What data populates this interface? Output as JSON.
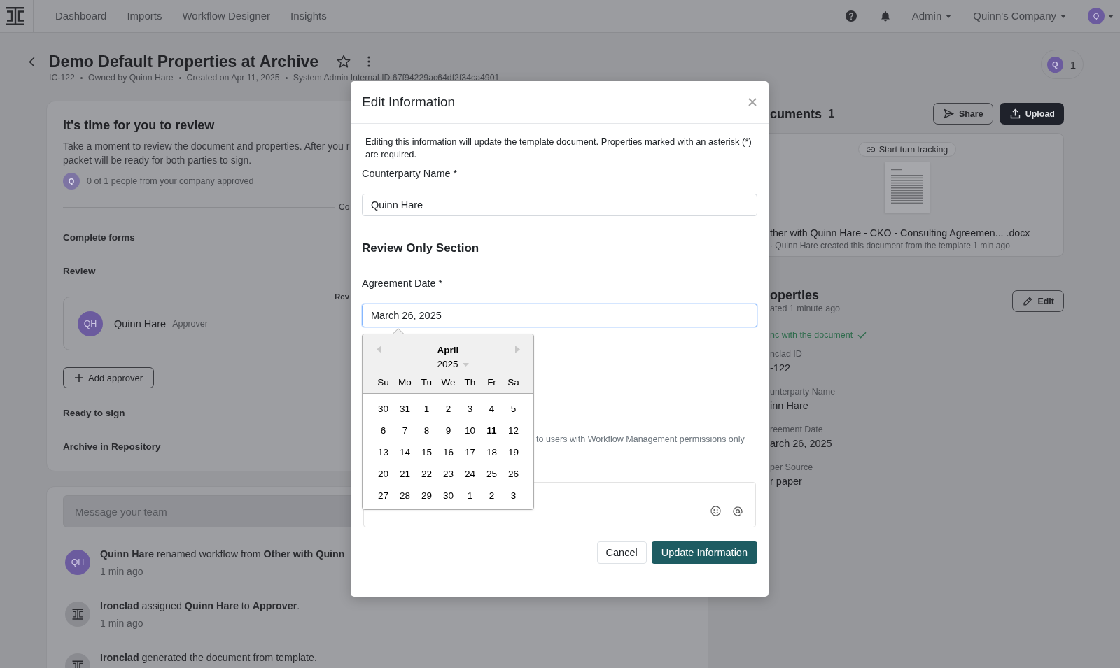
{
  "top_nav": {
    "links": [
      {
        "label": "Dashboard",
        "selected": false
      },
      {
        "label": "Imports",
        "selected": false
      },
      {
        "label": "Workflow Designer",
        "selected": false
      },
      {
        "label": "Insights",
        "selected": false
      }
    ],
    "menus": [
      "Admin",
      "Quinn's Company"
    ],
    "avatar": "Q"
  },
  "header": {
    "title": "Demo Default Properties at Archive",
    "starred": false,
    "meta": [
      "IC-122",
      "Owned by Quinn Hare",
      "Created on Apr 11, 2025",
      "System Admin Internal ID 67f94229ac64df2f34ca4901"
    ],
    "viewers": {
      "avatar": "Q",
      "count": "1"
    }
  },
  "review_card": {
    "title": "It's time for you to review",
    "lines": [
      "Take a moment to review the document and properties. After you r",
      "packet will be ready for both parties to sign."
    ],
    "approval": {
      "avatar": "Q",
      "text": "0 of 1 people from your company approved"
    },
    "divider_label": "Co",
    "steps": [
      "Complete forms",
      "Review"
    ],
    "approver_group": {
      "label": "Rev",
      "approvers": [
        {
          "initials": "QH",
          "name": "Quinn Hare",
          "role": "Approver"
        }
      ]
    },
    "add_button": "Add approver",
    "later_steps": [
      "Ready to sign",
      "Archive in Repository"
    ]
  },
  "activity": {
    "placeholder": "Message your team",
    "items": [
      {
        "kind": "person",
        "initials": "QH",
        "text": "**Quinn Hare** renamed workflow from **Other with Quinn**",
        "time": "1 min ago"
      },
      {
        "kind": "system",
        "text": "**Ironclad** assigned **Quinn Hare** to **Approver**.",
        "time": "1 min ago"
      },
      {
        "kind": "system",
        "text": "**Ironclad** generated the document from template."
      }
    ]
  },
  "documents": {
    "title": "cuments",
    "count": "1",
    "share_button": "Share",
    "upload_button": "Upload",
    "card": {
      "tracking_button": "Start turn tracking",
      "filename": "ther with Quinn Hare - CKO - Consulting Agreemen... .docx",
      "caption": "· Quinn Hare created this document from the template 1 min ago"
    }
  },
  "properties": {
    "title": "operties",
    "updated": "ated 1 minute ago",
    "edit_button": "Edit",
    "sync_status": "nc with the document",
    "fields": [
      {
        "label": "nclad ID",
        "value": "-122"
      },
      {
        "label": "unterparty Name",
        "value": "inn Hare"
      },
      {
        "label": "reement Date",
        "value": "arch 26, 2025"
      },
      {
        "label": "per Source",
        "value": "r paper"
      }
    ]
  },
  "modal": {
    "title": "Edit Information",
    "intro": "Editing this information will update the template document. Properties marked with an asterisk (*) are required.",
    "name_field": {
      "label": "Counterparty Name *",
      "value": "Quinn Hare",
      "focused": false
    },
    "section_title": "Review Only Section",
    "date_field": {
      "label": "Agreement Date *",
      "value": "March 26, 2025",
      "focused": true
    },
    "note": "to users with Workflow Management permissions only",
    "cancel_button": "Cancel",
    "submit_button": "Update Information",
    "datepicker": {
      "month": "April",
      "year": "2025",
      "weekdays": [
        "Su",
        "Mo",
        "Tu",
        "We",
        "Th",
        "Fr",
        "Sa"
      ],
      "weeks": [
        [
          {
            "day": "30",
            "today": false
          },
          {
            "day": "31",
            "today": false
          },
          {
            "day": "1",
            "today": false
          },
          {
            "day": "2",
            "today": false
          },
          {
            "day": "3",
            "today": false
          },
          {
            "day": "4",
            "today": false
          },
          {
            "day": "5",
            "today": false
          }
        ],
        [
          {
            "day": "6",
            "today": false
          },
          {
            "day": "7",
            "today": false
          },
          {
            "day": "8",
            "today": false
          },
          {
            "day": "9",
            "today": false
          },
          {
            "day": "10",
            "today": false
          },
          {
            "day": "11",
            "today": true
          },
          {
            "day": "12",
            "today": false
          }
        ],
        [
          {
            "day": "13",
            "today": false
          },
          {
            "day": "14",
            "today": false
          },
          {
            "day": "15",
            "today": false
          },
          {
            "day": "16",
            "today": false
          },
          {
            "day": "17",
            "today": false
          },
          {
            "day": "18",
            "today": false
          },
          {
            "day": "19",
            "today": false
          }
        ],
        [
          {
            "day": "20",
            "today": false
          },
          {
            "day": "21",
            "today": false
          },
          {
            "day": "22",
            "today": false
          },
          {
            "day": "23",
            "today": false
          },
          {
            "day": "24",
            "today": false
          },
          {
            "day": "25",
            "today": false
          },
          {
            "day": "26",
            "today": false
          }
        ],
        [
          {
            "day": "27",
            "today": false
          },
          {
            "day": "28",
            "today": false
          },
          {
            "day": "29",
            "today": false
          },
          {
            "day": "30",
            "today": false
          },
          {
            "day": "1",
            "today": false
          },
          {
            "day": "2",
            "today": false
          },
          {
            "day": "3",
            "today": false
          }
        ]
      ]
    }
  }
}
